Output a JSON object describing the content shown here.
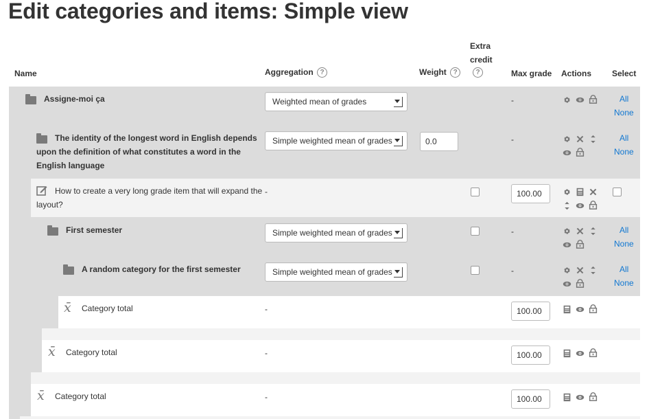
{
  "page_title": "Edit categories and items: Simple view",
  "columns": {
    "name": "Name",
    "aggregation": "Aggregation",
    "weight": "Weight",
    "extra_credit_line1": "Extra",
    "extra_credit_line2": "credit",
    "max_grade": "Max grade",
    "actions": "Actions",
    "select": "Select",
    "help_icon": "question-circle-icon"
  },
  "rows": {
    "r1": {
      "name": "Assigne-moi ça",
      "aggregation": "Weighted mean of grades",
      "max_grade": "-",
      "all": "All",
      "none": "None"
    },
    "r2": {
      "name_line1": "The identity of the longest word in English depends",
      "name_line2": "upon the definition of what constitutes a word in the",
      "name_line3": "English language",
      "aggregation": "Simple weighted mean of grades",
      "weight": "0.0",
      "max_grade": "-",
      "all": "All",
      "none": "None"
    },
    "r3": {
      "name_line1": "How to create a very long grade item that will expand the",
      "name_line2": "layout?",
      "aggregation": "-",
      "max_grade": "100.00"
    },
    "r4": {
      "name": "First semester",
      "aggregation": "Simple weighted mean of grades",
      "max_grade": "-",
      "all": "All",
      "none": "None"
    },
    "r5": {
      "name": "A random category for the first semester",
      "aggregation": "Simple weighted mean of grades",
      "max_grade": "-",
      "all": "All",
      "none": "None"
    },
    "r6": {
      "name": "Category total",
      "aggregation": "-",
      "max_grade": "100.00"
    },
    "r7": {
      "name": "Category total",
      "aggregation": "-",
      "max_grade": "100.00"
    },
    "r8": {
      "name": "Category total",
      "aggregation": "-",
      "max_grade": "100.00"
    }
  },
  "colors": {
    "gray_row": "#dcdcdc",
    "light_row": "#f3f3f3",
    "link": "#1177d1"
  },
  "icons": [
    "gear-icon",
    "eye-icon",
    "lock-icon",
    "close-icon",
    "move-icon",
    "edit-icon",
    "calculator-icon",
    "sigma-total-icon",
    "folder-icon"
  ]
}
